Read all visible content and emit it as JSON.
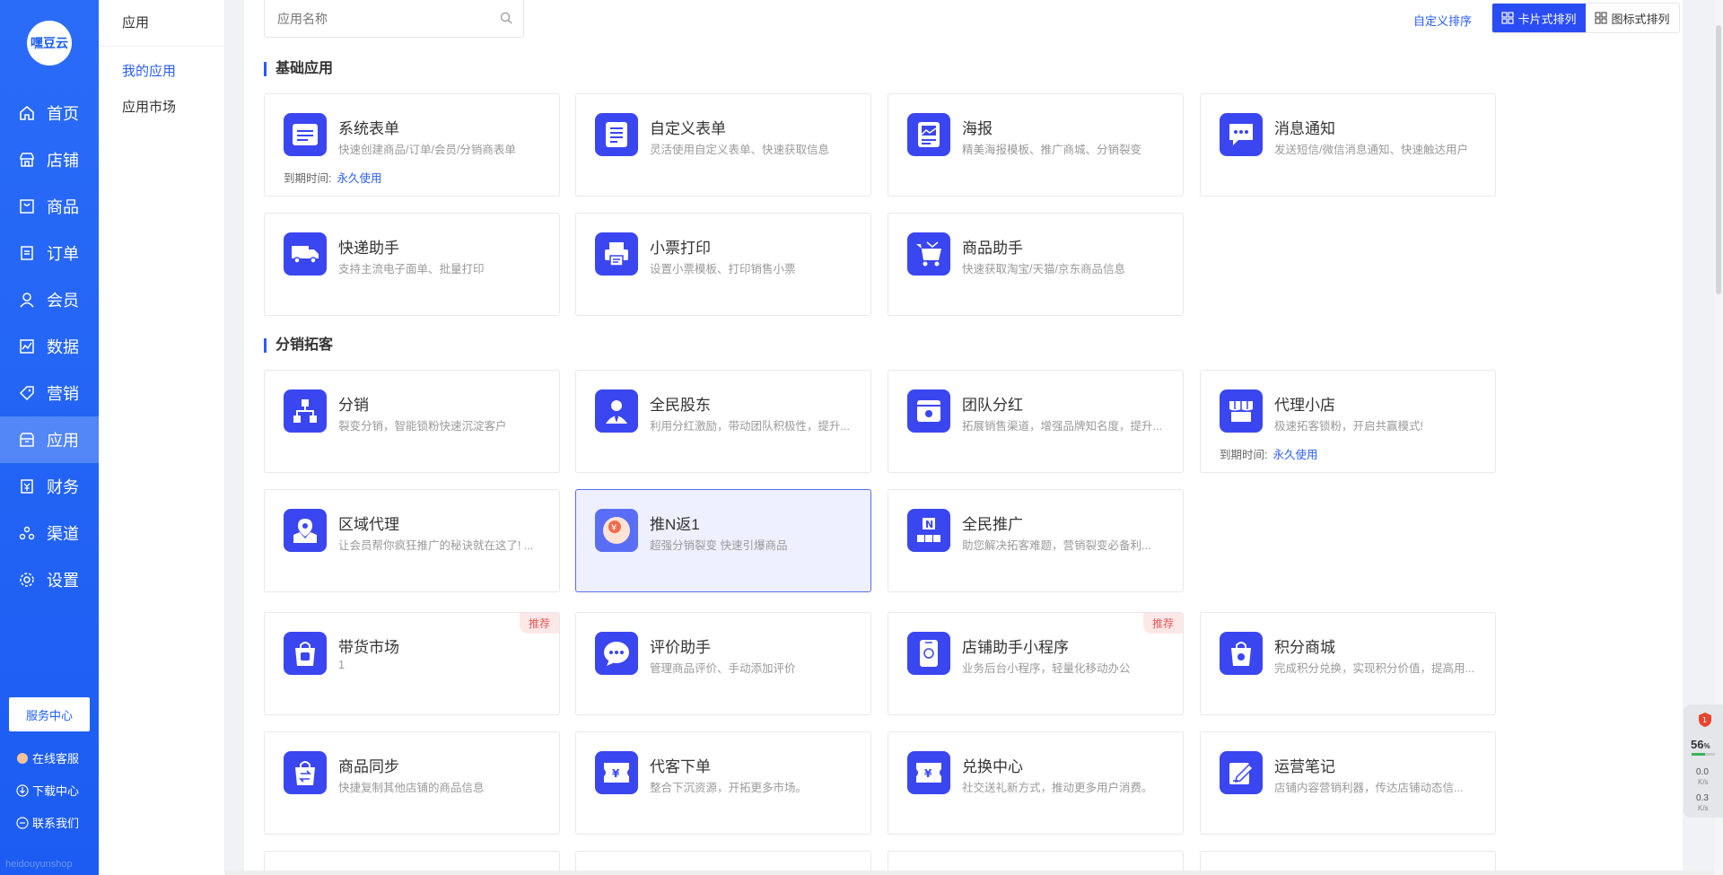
{
  "sidebar": {
    "logo_text": "嘿豆云",
    "items": [
      {
        "label": "首页",
        "icon": "home-icon"
      },
      {
        "label": "店铺",
        "icon": "store-icon"
      },
      {
        "label": "商品",
        "icon": "goods-icon"
      },
      {
        "label": "订单",
        "icon": "order-icon"
      },
      {
        "label": "会员",
        "icon": "member-icon"
      },
      {
        "label": "数据",
        "icon": "chart-icon"
      },
      {
        "label": "营销",
        "icon": "tag-icon"
      },
      {
        "label": "应用",
        "icon": "app-icon",
        "active": true
      },
      {
        "label": "财务",
        "icon": "finance-icon"
      },
      {
        "label": "渠道",
        "icon": "channel-icon"
      },
      {
        "label": "设置",
        "icon": "settings-icon"
      }
    ],
    "service_button": "服务中心",
    "links": [
      "在线客服",
      "下载中心",
      "联系我们"
    ],
    "footer_brand": "heidouyunshop"
  },
  "subsidebar": {
    "title": "应用",
    "items": [
      "我的应用",
      "应用市场"
    ]
  },
  "toolbar": {
    "search_placeholder": "应用名称",
    "custom_sort": "自定义排序",
    "view_card": "卡片式排列",
    "view_icon": "图标式排列"
  },
  "sections": [
    {
      "title": "基础应用",
      "cards": [
        {
          "name": "系统表单",
          "desc": "快速创建商品/订单/会员/分销商表单",
          "expire_label": "到期时间:",
          "expire_value": "永久使用"
        },
        {
          "name": "自定义表单",
          "desc": "灵活使用自定义表单、快速获取信息"
        },
        {
          "name": "海报",
          "desc": "精美海报模板、推广商城、分销裂变"
        },
        {
          "name": "消息通知",
          "desc": "发送短信/微信消息通知、快速触达用户"
        },
        {
          "name": "快递助手",
          "desc": "支持主流电子面单、批量打印"
        },
        {
          "name": "小票打印",
          "desc": "设置小票模板、打印销售小票"
        },
        {
          "name": "商品助手",
          "desc": "快速获取淘宝/天猫/京东商品信息"
        }
      ]
    },
    {
      "title": "分销拓客",
      "cards": [
        {
          "name": "分销",
          "desc": "裂变分销，智能锁粉快速沉淀客户"
        },
        {
          "name": "全民股东",
          "desc": "利用分红激励，带动团队积极性，提升..."
        },
        {
          "name": "团队分红",
          "desc": "拓展销售渠道，增强品牌知名度，提升..."
        },
        {
          "name": "代理小店",
          "desc": "极速拓客锁粉，开启共赢模式!",
          "expire_label": "到期时间:",
          "expire_value": "永久使用"
        },
        {
          "name": "区域代理",
          "desc": "让会员帮你疯狂推广的秘诀就在这了! ..."
        },
        {
          "name": "推N返1",
          "desc": "超强分销裂变 快速引爆商品"
        },
        {
          "name": "全民推广",
          "desc": "助您解决拓客难题，营销裂变必备利..."
        },
        {
          "name": "带货市场",
          "desc": "1",
          "badge": "推荐"
        },
        {
          "name": "评价助手",
          "desc": "管理商品评价、手动添加评价"
        },
        {
          "name": "店铺助手小程序",
          "desc": "业务后台小程序，轻量化移动办公",
          "badge": "推荐"
        },
        {
          "name": "积分商城",
          "desc": "完成积分兑换，实现积分价值，提高用..."
        },
        {
          "name": "商品同步",
          "desc": "快捷复制其他店铺的商品信息"
        },
        {
          "name": "代客下单",
          "desc": "整合下沉资源，开拓更多市场。"
        },
        {
          "name": "兑换中心",
          "desc": "社交送礼新方式，推动更多用户消费。"
        },
        {
          "name": "运营笔记",
          "desc": "店铺内容营销利器，传达店铺动态信..."
        }
      ]
    }
  ],
  "widget": {
    "alert_count": "1",
    "percent": "56",
    "percent_unit": "%",
    "up_speed": "0.0",
    "down_speed": "0.3",
    "speed_unit": "K/s",
    "level": 0.56
  },
  "colors": {
    "primary": "#2a5cf5",
    "icon_bg": "#3a46f0",
    "badge_bg": "#fde8e8",
    "badge_text": "#e85a5a"
  }
}
